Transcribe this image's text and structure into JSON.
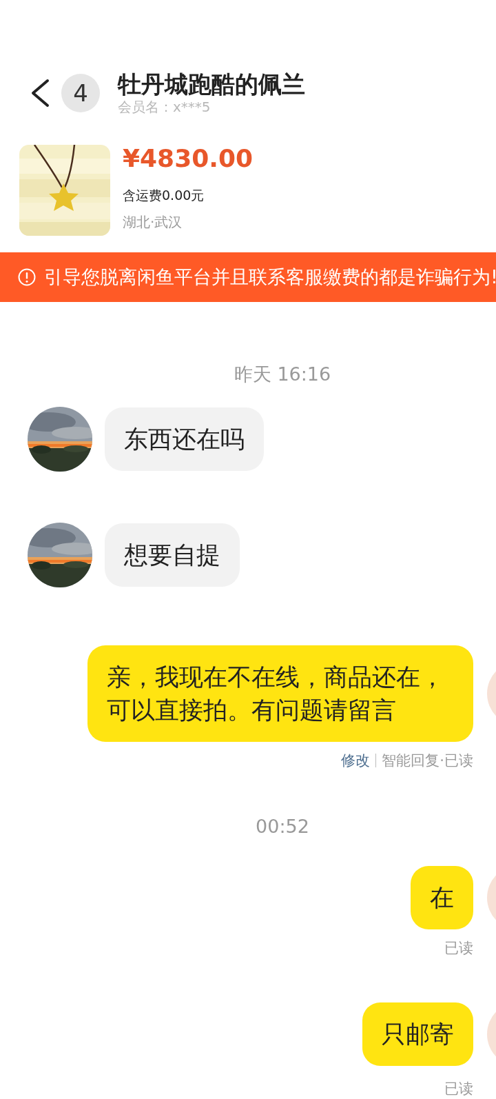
{
  "header": {
    "unread_count": "4",
    "title": "牡丹城跑酷的佩兰",
    "member_name": "会员名：x***5"
  },
  "product": {
    "price": "¥4830.00",
    "shipping": "含运费0.00元",
    "location": "湖北·武汉"
  },
  "warning_banner": {
    "text": "引导您脱离闲鱼平台并且联系客服缴费的都是诈骗行为!"
  },
  "messages": [
    {
      "kind": "time",
      "text": "昨天 16:16"
    },
    {
      "kind": "incoming",
      "text": "东西还在吗"
    },
    {
      "kind": "incoming",
      "text": "想要自提"
    },
    {
      "kind": "outgoing",
      "text": "亲，我现在不在线，商品还在，可以直接拍。有问题请留言",
      "edit_link": "修改",
      "status": "智能回复·已读"
    },
    {
      "kind": "time",
      "text": "00:52"
    },
    {
      "kind": "outgoing",
      "text": "在",
      "status": "已读"
    },
    {
      "kind": "outgoing",
      "text": "只邮寄",
      "status": "已读"
    }
  ]
}
